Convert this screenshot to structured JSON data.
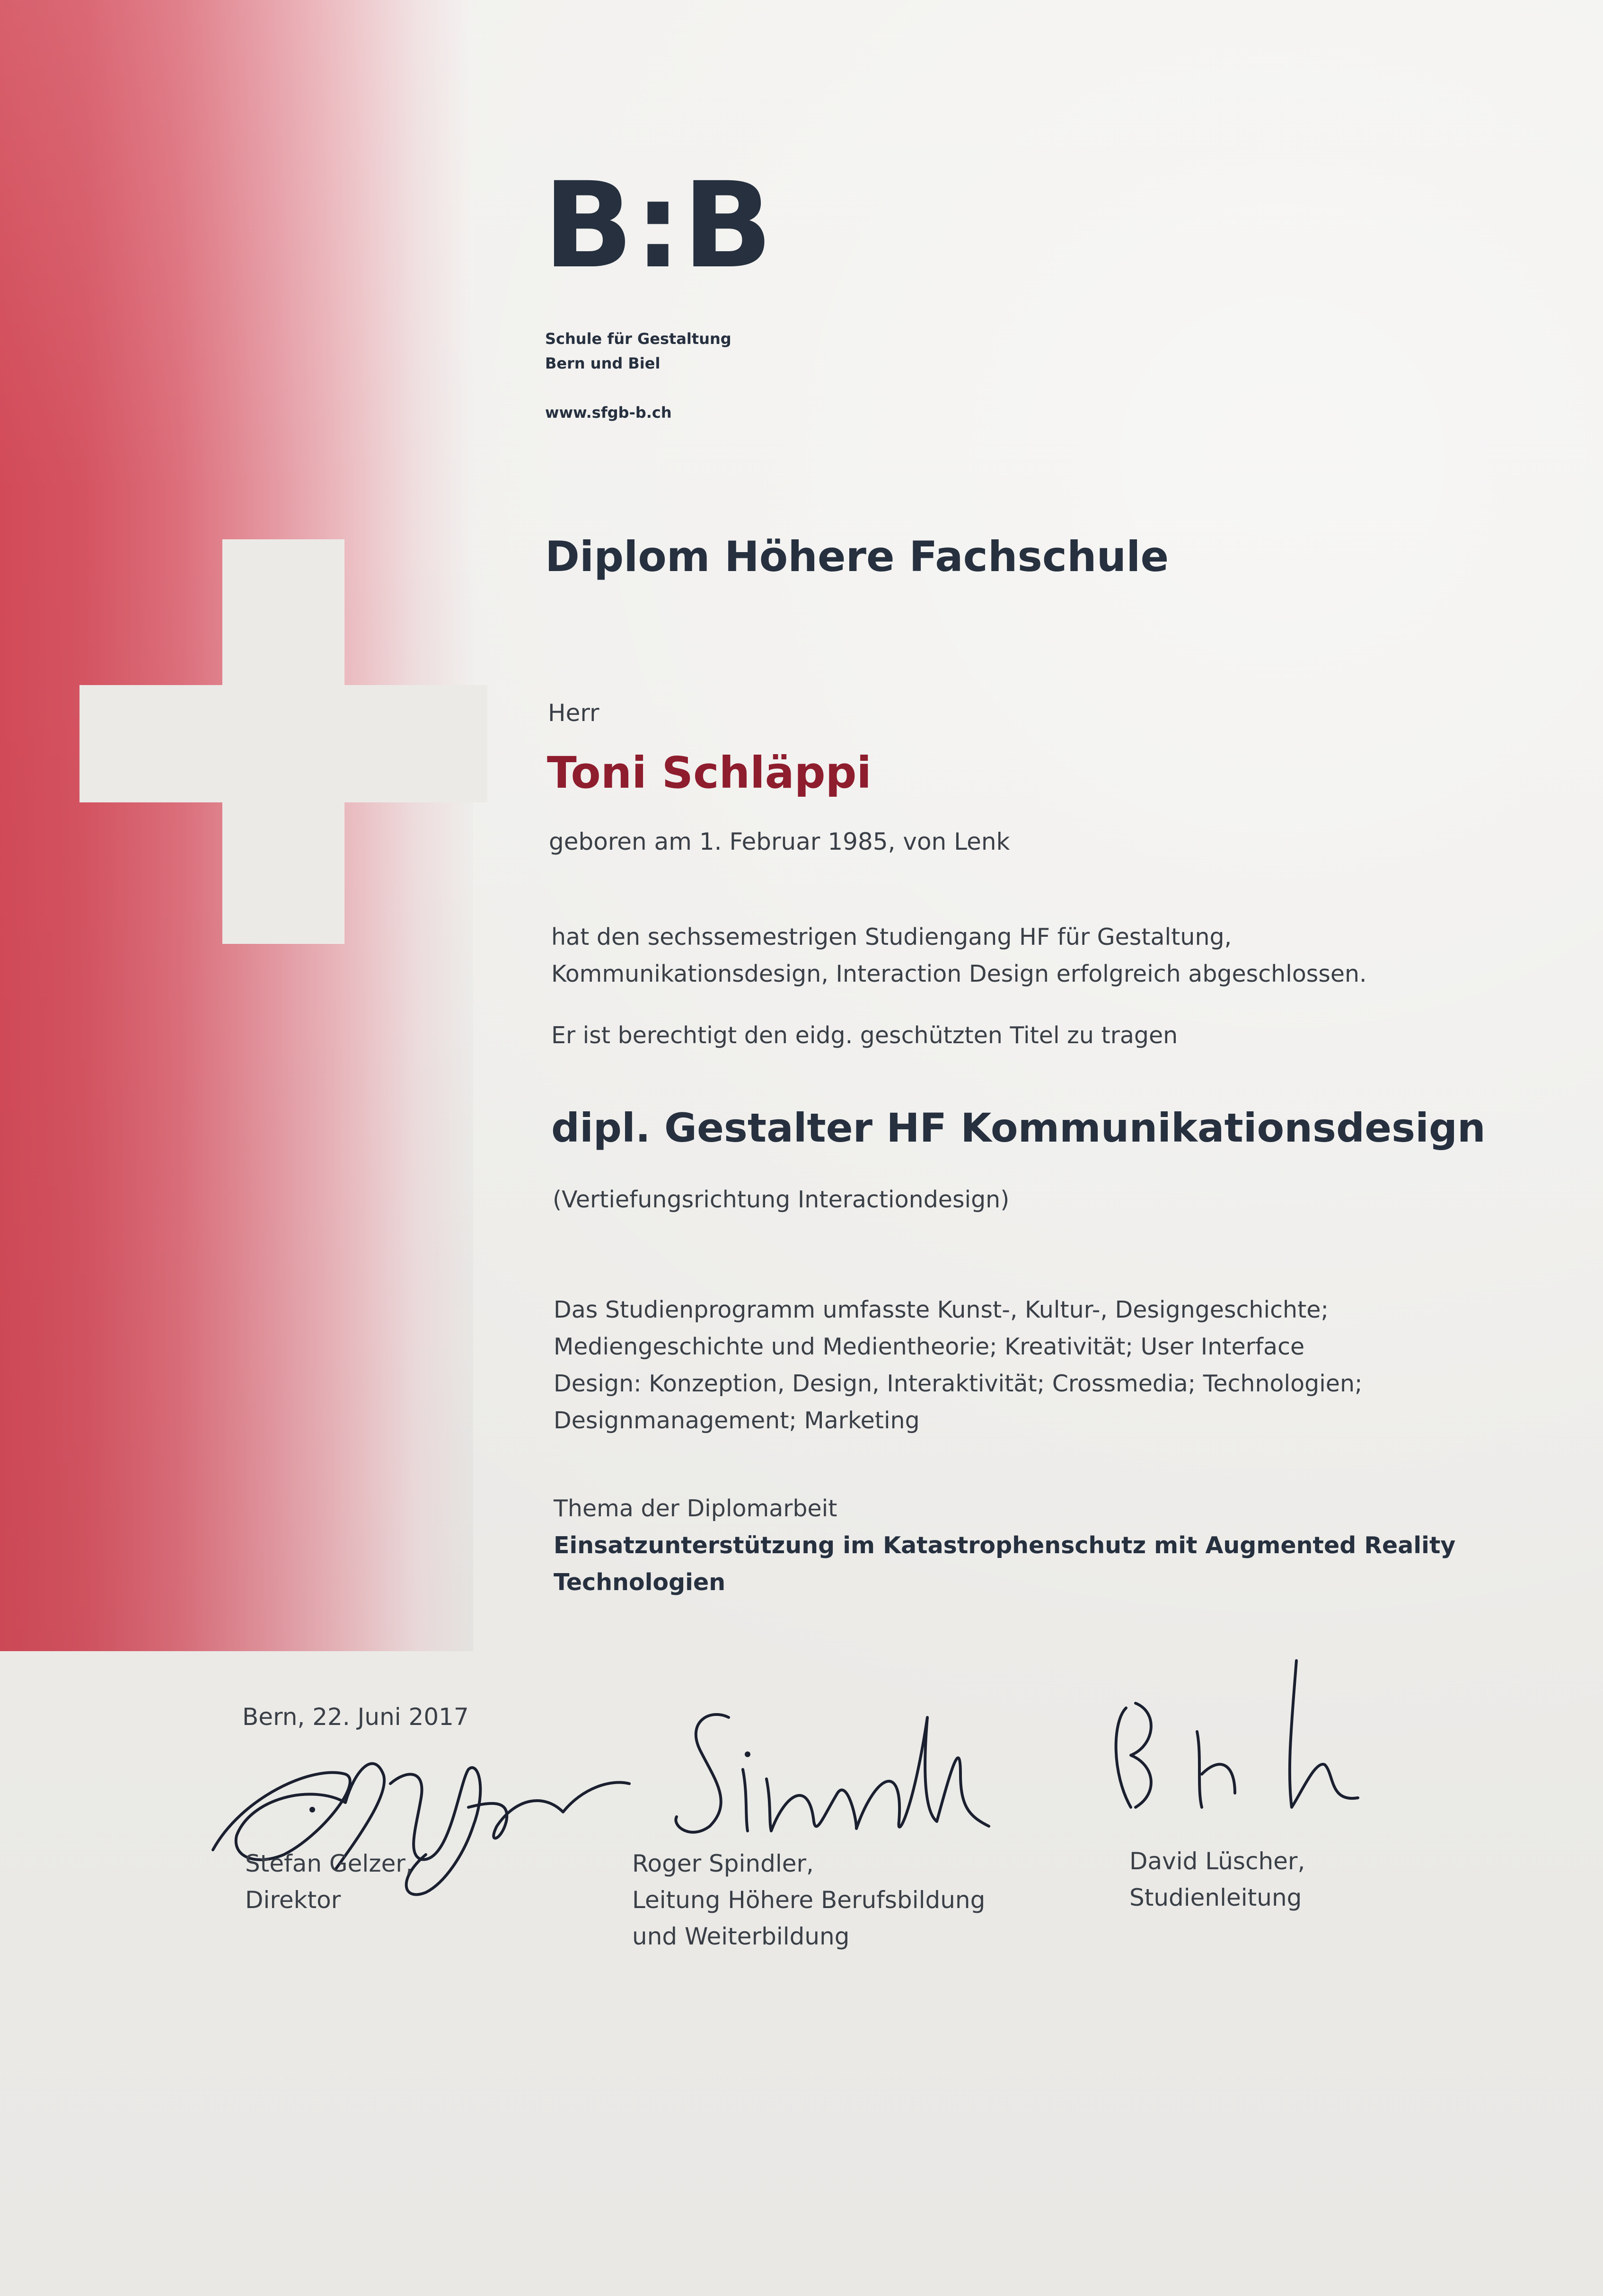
{
  "logo": {
    "mark": "B:B",
    "line1": "Schule für Gestaltung",
    "line2": "Bern und Biel",
    "url": "www.sfgb-b.ch"
  },
  "heading": "Diplom Höhere Fachschule",
  "salutation": "Herr",
  "recipient": "Toni Schläppi",
  "birth": "geboren am 1. Februar 1985, von Lenk",
  "completion": [
    "hat den sechssemestrigen Studiengang HF für Gestaltung,",
    "Kommunikationsdesign, Interaction Design erfolgreich abgeschlossen."
  ],
  "entitled": "Er ist berechtigt den eidg. geschützten Titel zu tragen",
  "degree_title": "dipl. Gestalter HF Kommunikationsdesign",
  "specialization": "(Vertiefungsrichtung Interactiondesign)",
  "program": [
    "Das Studienprogramm umfasste Kunst-, Kultur-, Designgeschichte;",
    "Mediengeschichte und Medientheorie; Kreativität; User Interface",
    "Design: Konzeption, Design, Interaktivität; Crossmedia; Technologien;",
    "Designmanagement; Marketing"
  ],
  "thesis": {
    "label": "Thema der Diplomarbeit",
    "lines": [
      "Einsatzunterstützung im Katastrophenschutz mit Augmented Reality",
      "Technologien"
    ]
  },
  "place_date": "Bern, 22. Juni 2017",
  "signatories": [
    {
      "name": "Stefan Gelzer,",
      "role": [
        "Direktor"
      ]
    },
    {
      "name": "Roger Spindler,",
      "role": [
        "Leitung Höhere Berufsbildung",
        "und Weiterbildung"
      ]
    },
    {
      "name": "David Lüscher,",
      "role": [
        "Studienleitung"
      ]
    }
  ],
  "colors": {
    "ink": "#26303f",
    "name_red": "#8e1d2e",
    "band_red": "#d24a58"
  }
}
